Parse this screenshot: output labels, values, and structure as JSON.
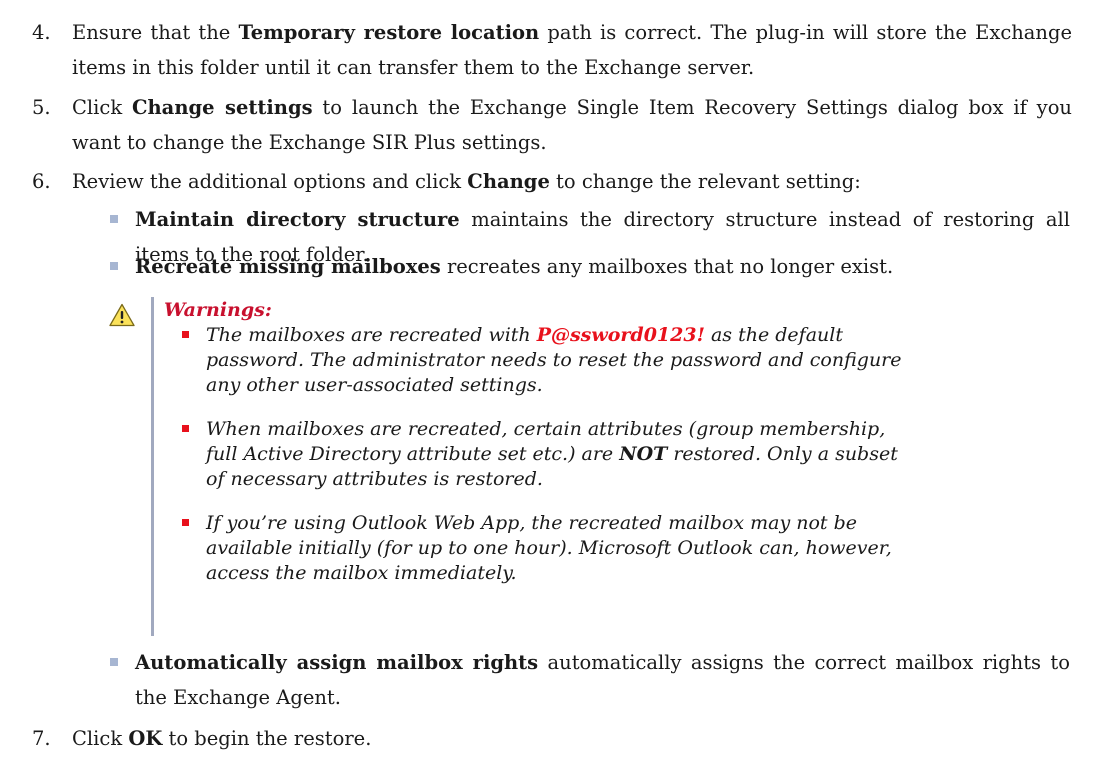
{
  "steps": [
    {
      "num": "4.",
      "pre": "Ensure that the ",
      "bold": "Temporary restore location",
      "post": " path is correct. The plug-in will store the Exchange items in this folder until it can transfer them to the Exchange server."
    },
    {
      "num": "5.",
      "pre": "Click ",
      "bold": "Change settings",
      "post": " to launch the Exchange Single Item Recovery Settings dialog box if you want to change the Exchange SIR Plus settings."
    },
    {
      "num": "6.",
      "pre": "Review the additional options and click ",
      "bold": "Change",
      "post": " to change the relevant setting:"
    },
    {
      "num": "7.",
      "pre": "Click ",
      "bold": "OK",
      "post": " to begin the restore."
    }
  ],
  "options": [
    {
      "bold": "Maintain directory structure",
      "post": " maintains the directory structure instead of restoring all items to the root folder."
    },
    {
      "bold": "Recreate missing mailboxes",
      "post": " recreates any mailboxes that no longer exist."
    },
    {
      "bold": "Automatically assign mailbox rights",
      "post": " automatically assigns the correct mailbox rights to the Exchange Agent."
    }
  ],
  "warning": {
    "icon": "warning-triangle-icon",
    "title": "Warnings:",
    "item1": {
      "pre": "The mailboxes are recreated with ",
      "red": "P@ssword0123!",
      "post": " as the default password. The administrator needs to reset the password and configure any other user-associated settings."
    },
    "item2": {
      "pre": "When mailboxes are recreated, certain attributes (group membership, full Active Directory attribute set etc.) are ",
      "bold": "NOT",
      "post": " restored. Only a subset of necessary attributes is restored."
    },
    "item3": {
      "text": "If you’re using Outlook Web App, the recreated mailbox may not be available initially (for up to one hour). Microsoft Outlook can, however, access the mailbox immediately."
    }
  },
  "colors": {
    "text": "#1a1a1a",
    "option_bullet": "#a7b6d2",
    "warning_bar": "#a1a9bf",
    "warning_red": "#e8111c",
    "warning_title": "#c8102e"
  }
}
